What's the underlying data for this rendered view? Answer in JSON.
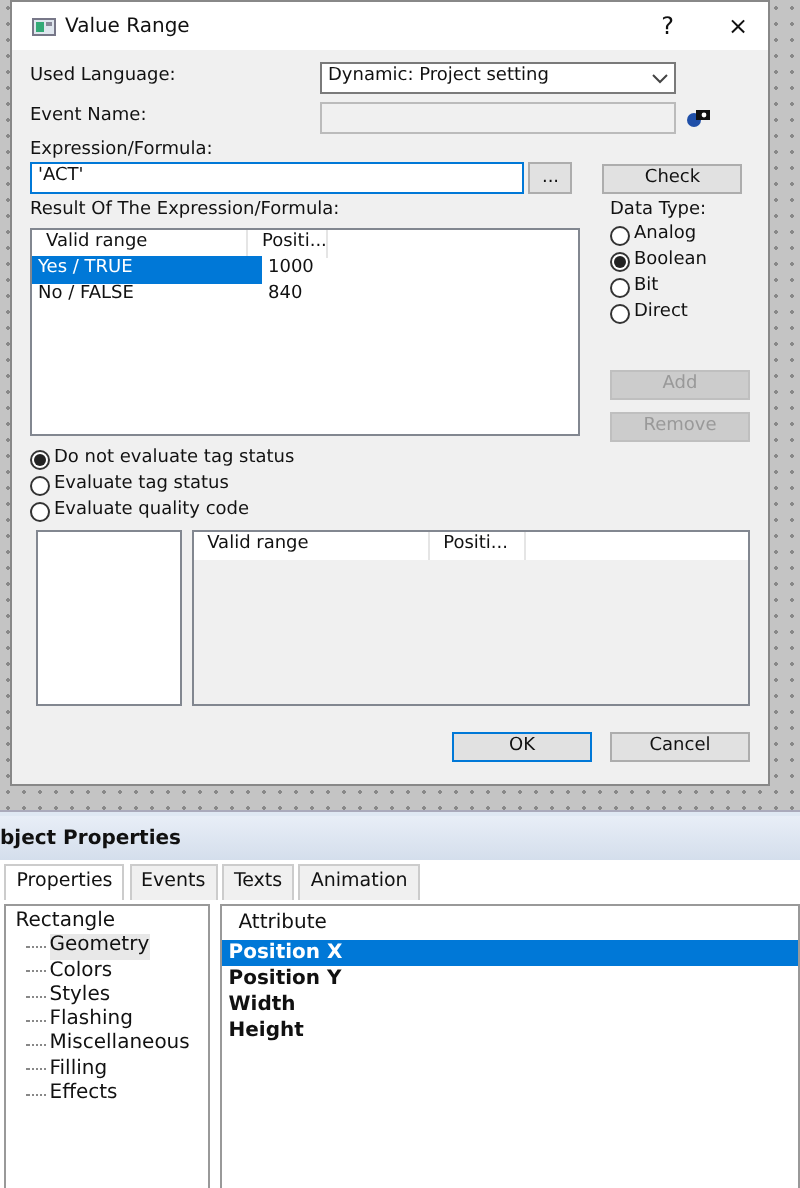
{
  "dialog": {
    "title": "Value Range",
    "help": "?",
    "close": "×",
    "used_language": {
      "label": "Used Language:",
      "value": "Dynamic: Project setting"
    },
    "event_name": {
      "label": "Event Name:",
      "disabled": true
    },
    "expression": {
      "label": "Expression/Formula:",
      "value": "'ACT'",
      "browse": "...",
      "check": "Check"
    },
    "result": {
      "label": "Result Of The Expression/Formula:",
      "columns": [
        "Valid range",
        "Positi..."
      ],
      "rows": [
        {
          "cells": [
            "Yes / TRUE",
            "1000"
          ],
          "selected": true
        },
        {
          "cells": [
            "No / FALSE",
            "840"
          ],
          "selected": false
        }
      ]
    },
    "data_type": {
      "label": "Data Type:",
      "options": [
        {
          "label": "Analog",
          "selected": false
        },
        {
          "label": "Boolean",
          "selected": true
        },
        {
          "label": "Bit",
          "selected": false
        },
        {
          "label": "Direct",
          "selected": false
        }
      ]
    },
    "side_buttons": [
      {
        "label": "Add",
        "disabled": true
      },
      {
        "label": "Remove",
        "disabled": true
      }
    ],
    "evaluation": [
      {
        "label": "Do not evaluate tag status",
        "selected": true
      },
      {
        "label": "Evaluate tag status",
        "selected": false
      },
      {
        "label": "Evaluate quality code",
        "selected": false
      }
    ],
    "lower_table": {
      "columns": [
        "Valid range",
        "Positi..."
      ]
    },
    "buttons": [
      {
        "label": "OK",
        "default": true
      },
      {
        "label": "Cancel",
        "default": false
      }
    ]
  },
  "object_properties": {
    "title": "bject Properties",
    "tabs": [
      {
        "label": "Properties",
        "selected": true
      },
      {
        "label": "Events",
        "selected": false
      },
      {
        "label": "Texts",
        "selected": false
      },
      {
        "label": "Animation",
        "selected": false
      }
    ],
    "tree": {
      "label": "Rectangle",
      "children": [
        {
          "label": "Geometry",
          "selected": true
        },
        {
          "label": "Colors",
          "selected": false
        },
        {
          "label": "Styles",
          "selected": false
        },
        {
          "label": "Flashing",
          "selected": false
        },
        {
          "label": "Miscellaneous",
          "selected": false
        },
        {
          "label": "Filling",
          "selected": false
        },
        {
          "label": "Effects",
          "selected": false
        }
      ]
    },
    "attributes": {
      "header": "Attribute",
      "rows": [
        {
          "label": "Position X",
          "selected": true
        },
        {
          "label": "Position Y",
          "selected": false
        },
        {
          "label": "Width",
          "selected": false
        },
        {
          "label": "Height",
          "selected": false
        }
      ]
    }
  }
}
